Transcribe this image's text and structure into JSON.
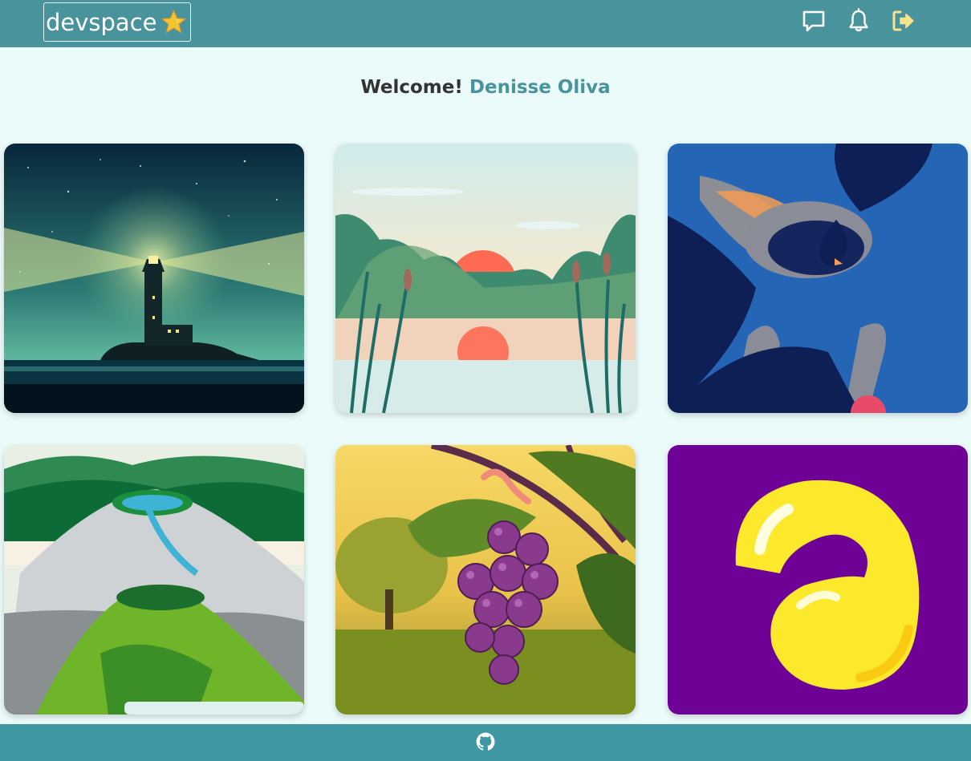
{
  "header": {
    "brand": "devspace",
    "icons": [
      "chat-icon",
      "bell-icon",
      "logout-icon"
    ]
  },
  "welcome": {
    "greeting": "Welcome!",
    "user_name": "Denisse Oliva"
  },
  "gallery": {
    "cards": [
      {
        "name": "lighthouse-illustration"
      },
      {
        "name": "sunset-lake-illustration"
      },
      {
        "name": "bird-illustration"
      },
      {
        "name": "volcano-illustration"
      },
      {
        "name": "grapes-illustration"
      },
      {
        "name": "yellow-shape-illustration"
      }
    ]
  },
  "footer": {
    "icon": "github-icon"
  },
  "colors": {
    "header_bg": "#48939c",
    "footer_bg": "#3f98a3",
    "page_bg": "#ebfbfa",
    "accent": "#48939c",
    "logout": "#f7e38a"
  }
}
